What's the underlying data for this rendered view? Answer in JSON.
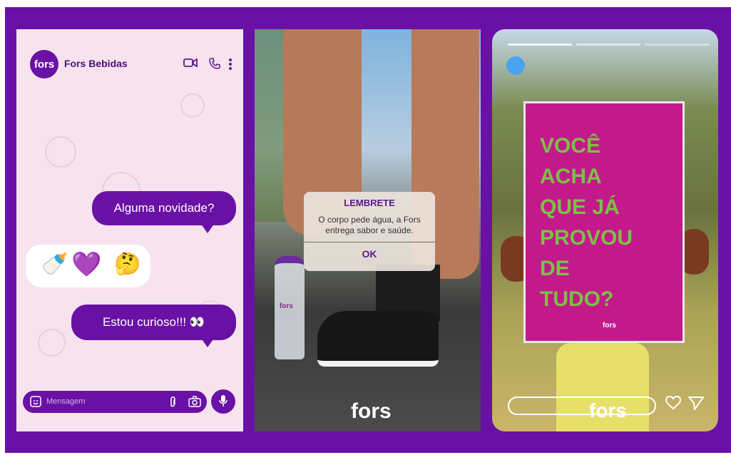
{
  "chat": {
    "logo_text": "fors",
    "contact_name": "Fors Bebidas",
    "messages": [
      {
        "text": "Alguma novidade?"
      },
      {
        "text": "Estou curioso!!! 👀"
      }
    ],
    "emojis": [
      "🍼",
      "💜",
      "🤔"
    ],
    "input_placeholder": "Mensagem",
    "icons": [
      "video-call-icon",
      "phone-icon",
      "more-options-icon",
      "sticker-icon",
      "attach-icon",
      "camera-icon",
      "microphone-icon"
    ]
  },
  "photo_panel": {
    "alert_title": "LEMBRETE",
    "alert_message": "O corpo pede água, a Fors entrega sabor e saúde.",
    "alert_ok": "OK",
    "watermark": "fors",
    "bottle_label": "fors"
  },
  "story_panel": {
    "sign_lines": [
      "VOCÊ",
      "ACHA",
      "QUE JÁ",
      "PROVOU",
      "DE",
      "TUDO?"
    ],
    "sign_logo": "fors",
    "watermark": "fors",
    "icons": [
      "heart-icon",
      "send-icon"
    ]
  },
  "colors": {
    "brand_purple": "#6a11a5",
    "chat_bg": "#f7e3ee",
    "sign_magenta": "#c31a8b",
    "sign_green": "#7bc143"
  }
}
